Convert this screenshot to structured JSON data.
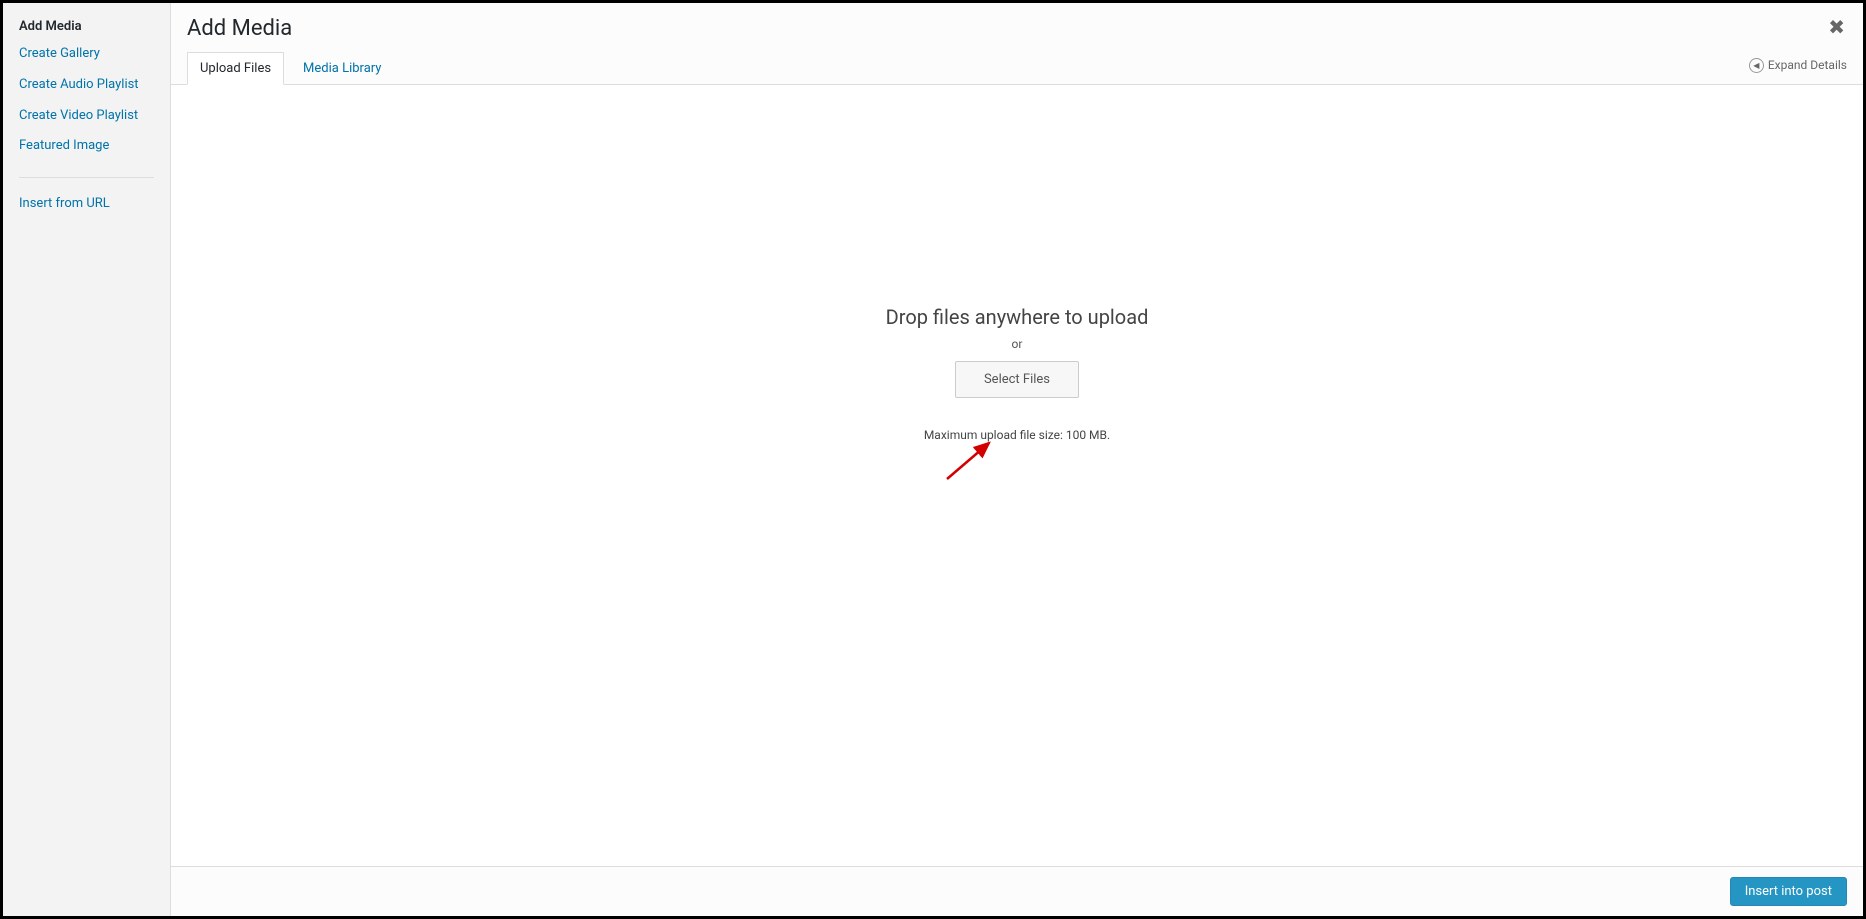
{
  "sidebar": {
    "title": "Add Media",
    "items": [
      {
        "label": "Create Gallery"
      },
      {
        "label": "Create Audio Playlist"
      },
      {
        "label": "Create Video Playlist"
      },
      {
        "label": "Featured Image"
      }
    ],
    "insert_url_label": "Insert from URL"
  },
  "header": {
    "title": "Add Media",
    "expand_details_label": "Expand Details"
  },
  "tabs": {
    "upload_label": "Upload Files",
    "media_library_label": "Media Library"
  },
  "upload": {
    "drop_text": "Drop files anywhere to upload",
    "or_text": "or",
    "select_files_label": "Select Files",
    "max_size_text": "Maximum upload file size: 100 MB."
  },
  "footer": {
    "insert_label": "Insert into post"
  }
}
